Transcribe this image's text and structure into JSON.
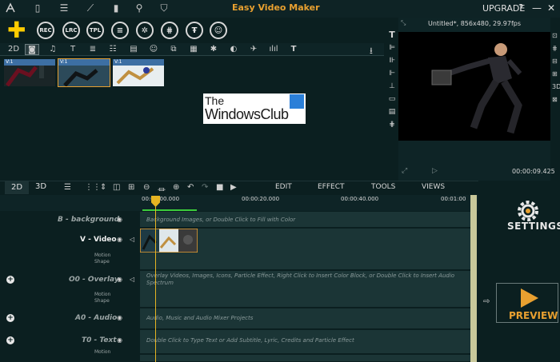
{
  "app": {
    "title": "Easy Video Maker",
    "upgrade_label": "UPGRADE",
    "help": "?",
    "minimize": "—",
    "close": "✕"
  },
  "toolbar": {
    "buttons": [
      "REC",
      "LRC",
      "TPL"
    ]
  },
  "preview": {
    "title": "Untitled*, 856x480, 29.97fps",
    "time": "00:00:09.425"
  },
  "media": {
    "thumbs": [
      "V:1",
      "V:1",
      "V:1"
    ]
  },
  "logo": {
    "line1": "The",
    "line2": "WindowsClub"
  },
  "timeline": {
    "tabs": [
      "2D",
      "3D"
    ],
    "menus": [
      "EDIT",
      "EFFECT",
      "TOOLS",
      "VIEWS"
    ],
    "ruler": [
      "00:00:00.000",
      "00:00:20.000",
      "00:00:40.000",
      "00:01:00"
    ],
    "tracks": [
      {
        "name": "B - background",
        "hint": "Background Images, or Double Click to Fill with Color"
      },
      {
        "name": "V - Video",
        "sub1": "Motion",
        "sub2": "Shape"
      },
      {
        "name": "O0 - Overlay",
        "sub1": "Motion",
        "sub2": "Shape",
        "hint": "Overlay Videos, Images, Icons, Particle Effect, Right Click to Insert Color Block, or Double Click to Insert Audio Spectrum"
      },
      {
        "name": "A0 - Audio",
        "hint": "Audio, Music and Audio Mixer Projects"
      },
      {
        "name": "T0 - Text",
        "sub1": "Motion",
        "hint": "Double Click to Type Text or Add Subtitle, Lyric, Credits and Particle Effect"
      }
    ]
  },
  "right": {
    "settings_label": "SETTINGS",
    "preview_label": "PREVIEW"
  },
  "colors": {
    "accent": "#e8a030",
    "background": "#0b1f20",
    "track": "#1b3536",
    "playhead": "#e6b422"
  }
}
